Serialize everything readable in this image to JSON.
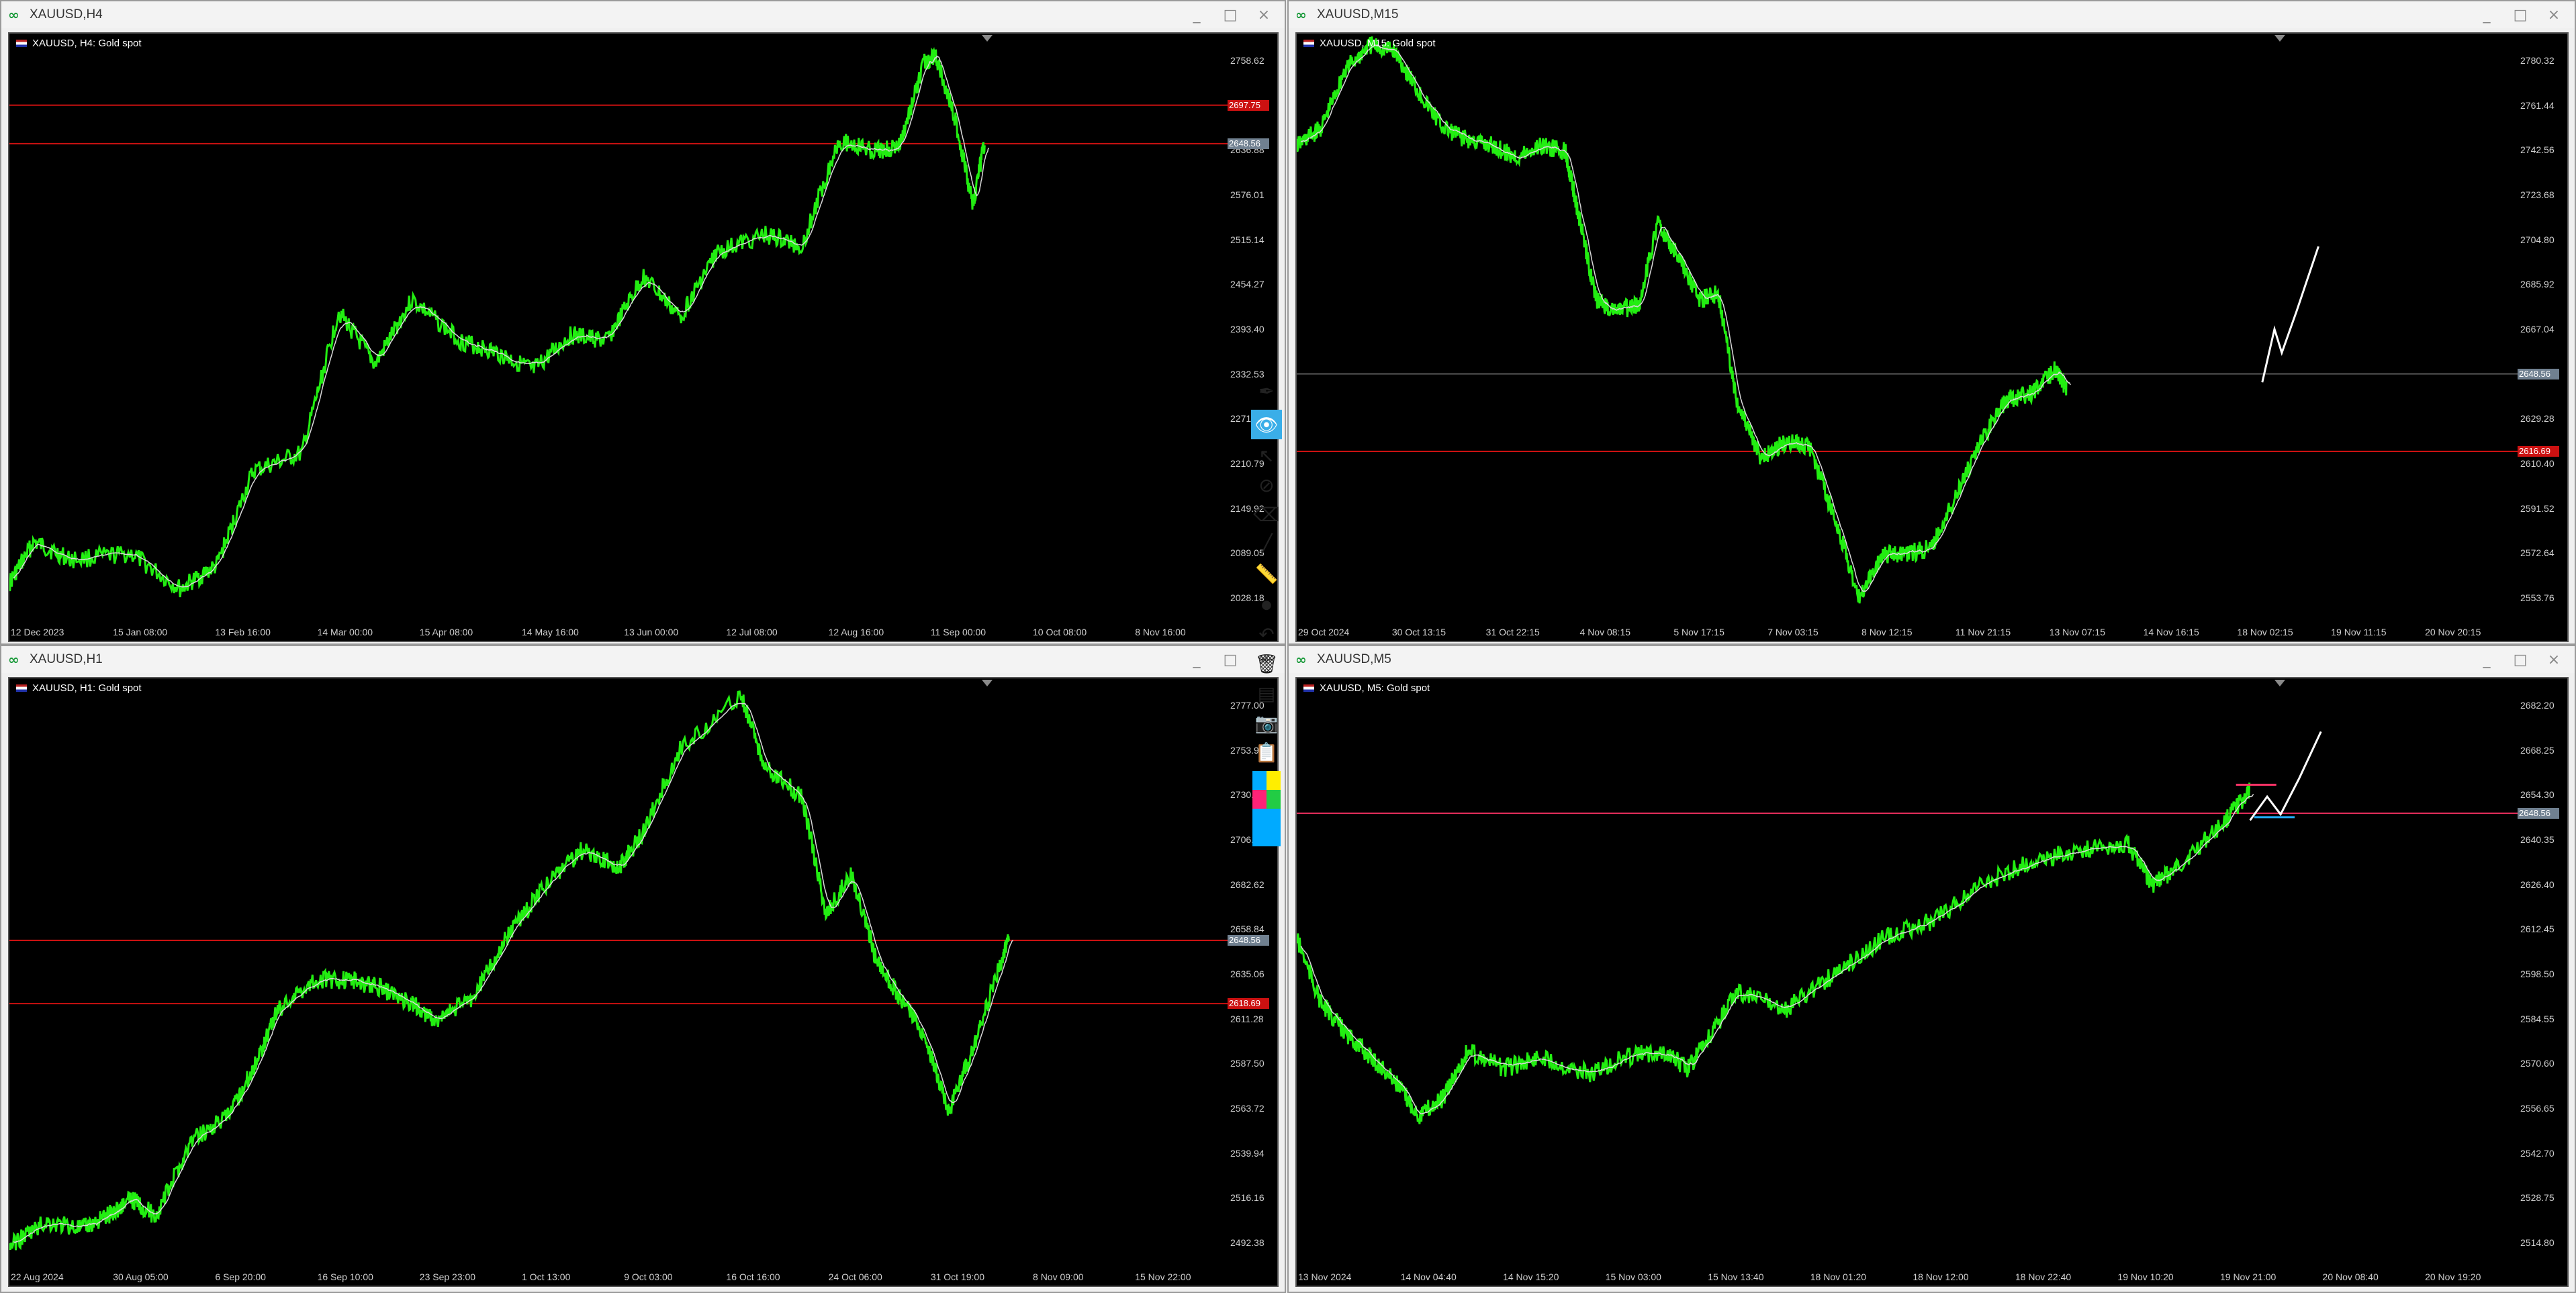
{
  "windows": [
    {
      "id": "h4",
      "title": "XAUUSD,H4",
      "info": "XAUUSD, H4:  Gold spot",
      "y_labels": [
        "2758.62",
        "2697.75",
        "2636.88",
        "2576.01",
        "2515.14",
        "2454.27",
        "2393.40",
        "2332.53",
        "2271.66",
        "2210.79",
        "2149.92",
        "2089.05",
        "2028.18"
      ],
      "x_labels": [
        "12 Dec 2023",
        "15 Jan 08:00",
        "13 Feb 16:00",
        "14 Mar 00:00",
        "15 Apr 08:00",
        "14 May 16:00",
        "13 Jun 00:00",
        "12 Jul 08:00",
        "12 Aug 16:00",
        "11 Sep 00:00",
        "10 Oct 08:00",
        "8 Nov 16:00"
      ],
      "tags": [
        {
          "label": "2697.75",
          "color": "#cc1111",
          "value": 2697.75
        },
        {
          "label": "2648.56",
          "color": "#708090",
          "value": 2645.5
        }
      ]
    },
    {
      "id": "m15",
      "title": "XAUUSD,M15",
      "info": "XAUUSD, M15:  Gold spot",
      "y_labels": [
        "2780.32",
        "2761.44",
        "2742.56",
        "2723.68",
        "2704.80",
        "2685.92",
        "2667.04",
        "2648.16",
        "2629.28",
        "2610.40",
        "2591.52",
        "2572.64",
        "2553.76"
      ],
      "x_labels": [
        "29 Oct 2024",
        "30 Oct 13:15",
        "31 Oct 22:15",
        "4 Nov 08:15",
        "5 Nov 17:15",
        "7 Nov 03:15",
        "8 Nov 12:15",
        "11 Nov 21:15",
        "13 Nov 07:15",
        "14 Nov 16:15",
        "18 Nov 02:15",
        "19 Nov 11:15",
        "20 Nov 20:15"
      ],
      "tags": [
        {
          "label": "2648.56",
          "color": "#708090",
          "value": 2648.16
        },
        {
          "label": "2616.69",
          "color": "#cc1111",
          "value": 2615.5
        }
      ]
    },
    {
      "id": "h1",
      "title": "XAUUSD,H1",
      "info": "XAUUSD, H1:  Gold spot",
      "y_labels": [
        "2777.00",
        "2753.96",
        "2730.00",
        "2706.00",
        "2682.62",
        "2658.84",
        "2635.06",
        "2611.28",
        "2587.50",
        "2563.72",
        "2539.94",
        "2516.16",
        "2492.38"
      ],
      "x_labels": [
        "22 Aug 2024",
        "30 Aug 05:00",
        "6 Sep 20:00",
        "16 Sep 10:00",
        "23 Sep 23:00",
        "1 Oct 13:00",
        "9 Oct 03:00",
        "16 Oct 16:00",
        "24 Oct 06:00",
        "31 Oct 19:00",
        "8 Nov 09:00",
        "15 Nov 22:00"
      ],
      "tags": [
        {
          "label": "2648.56",
          "color": "#708090",
          "value": 2652.5
        },
        {
          "label": "2618.69",
          "color": "#cc1111",
          "value": 2619.0
        }
      ]
    },
    {
      "id": "m5",
      "title": "XAUUSD,M5",
      "info": "XAUUSD, M5:  Gold spot",
      "y_labels": [
        "2682.20",
        "2668.25",
        "2654.30",
        "2640.35",
        "2626.40",
        "2612.45",
        "2598.50",
        "2584.55",
        "2570.60",
        "2556.65",
        "2542.70",
        "2528.75",
        "2514.80"
      ],
      "x_labels": [
        "13 Nov 2024",
        "14 Nov 04:40",
        "14 Nov 15:20",
        "15 Nov 03:00",
        "15 Nov 13:40",
        "18 Nov 01:20",
        "18 Nov 12:00",
        "18 Nov 22:40",
        "19 Nov 10:20",
        "19 Nov 21:00",
        "20 Nov 08:40",
        "20 Nov 19:20"
      ],
      "tags": [
        {
          "label": "2648.56",
          "color": "#708090",
          "value": 2648.56
        }
      ]
    }
  ],
  "window_buttons": {
    "minimize": "_",
    "maximize": "□",
    "close": "×"
  },
  "toolbar": {
    "items": [
      "pen-icon",
      "eye-icon",
      "cursor-icon",
      "hide-icon",
      "eraser-icon",
      "line-icon",
      "ruler-icon",
      "dot-icon",
      "undo-icon",
      "trash-icon",
      "stack-icon",
      "screenshot-icon",
      "clipboard-icon",
      "color-palette"
    ],
    "palette": [
      "#00aaff",
      "#ffee00",
      "#ff2277",
      "#22cc44",
      "#00aaff",
      "#00aaff"
    ]
  },
  "colors": {
    "candles": "#22ee11",
    "ma": "#d8d8d8",
    "hline_red": "#cc1111",
    "hline_pink": "#ff3366",
    "projection": "#ffffff"
  }
}
